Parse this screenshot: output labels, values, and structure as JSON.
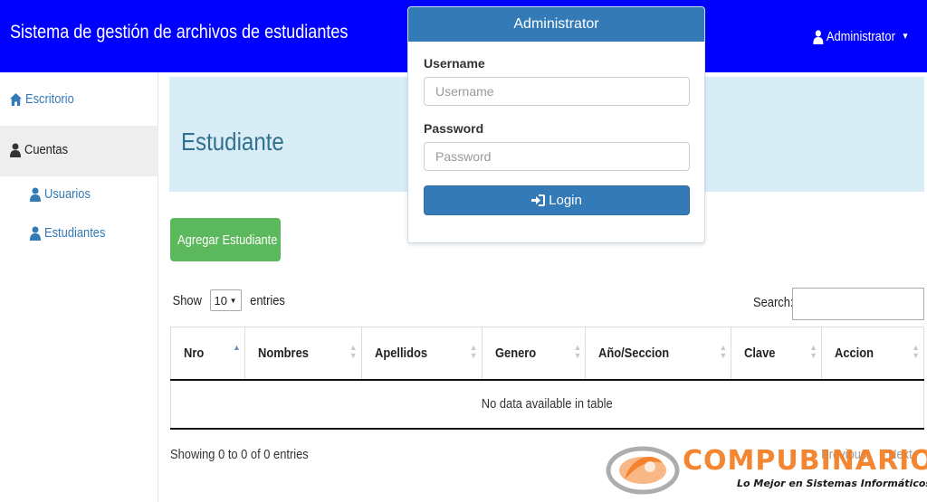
{
  "app": {
    "title": "Sistema de gestión de archivos de estudiantes"
  },
  "user_menu": {
    "label": "Administrator"
  },
  "sidebar": {
    "items": [
      {
        "label": "Escritorio",
        "icon": "home-icon"
      },
      {
        "label": "Cuentas",
        "icon": "user-icon",
        "active": true
      },
      {
        "label": "Usuarios",
        "icon": "user-icon"
      },
      {
        "label": "Estudiantes",
        "icon": "user-icon"
      }
    ]
  },
  "page": {
    "title": "Estudiante"
  },
  "actions": {
    "add_label": "Agregar Estudiante"
  },
  "length": {
    "prefix": "Show",
    "value": "10",
    "suffix": "entries"
  },
  "search": {
    "label": "Search:",
    "value": ""
  },
  "table": {
    "columns": [
      "Nro",
      "Nombres",
      "Apellidos",
      "Genero",
      "Año/Seccion",
      "Clave",
      "Accion"
    ],
    "empty_message": "No data available in table",
    "info": "Showing 0 to 0 of 0 entries",
    "prev_label": "Previous",
    "next_label": "Next"
  },
  "modal": {
    "title": "Administrator",
    "username_label": "Username",
    "username_placeholder": "Username",
    "password_label": "Password",
    "password_placeholder": "Password",
    "login_label": "Login"
  },
  "watermark": {
    "name": "COMPUBINARIO",
    "tagline": "Lo Mejor en Sistemas Informáticos"
  },
  "colors": {
    "navbar": "#0000ff",
    "primary": "#337ab7",
    "success": "#5cb85c",
    "header_bg": "#d9edf7",
    "watermark": "#f47b20"
  }
}
